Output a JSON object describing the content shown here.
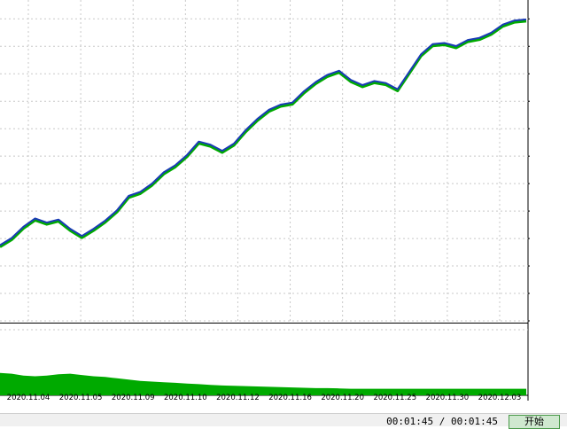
{
  "chart_data": [
    {
      "type": "line",
      "title": "",
      "xlabel": "",
      "ylabel": "",
      "ylim": [
        -68697,
        1460000
      ],
      "y_ticks": [
        1402557,
        1268806,
        1135056,
        1001306,
        867555,
        733805,
        600055,
        466305,
        332554,
        198804,
        65054,
        -68697
      ],
      "grid": true,
      "colors": {
        "balance": "#1a3bb5",
        "equity": "#00aa00"
      },
      "series": [
        {
          "values": [
            300000,
            335000,
            390000,
            430000,
            410000,
            425000,
            380000,
            345000,
            380000,
            420000,
            470000,
            540000,
            560000,
            600000,
            655000,
            690000,
            740000,
            805000,
            790000,
            760000,
            795000,
            860000,
            915000,
            960000,
            985000,
            995000,
            1050000,
            1095000,
            1130000,
            1150000,
            1105000,
            1080000,
            1100000,
            1090000,
            1060000,
            1145000,
            1230000,
            1280000,
            1285000,
            1270000,
            1300000,
            1310000,
            1335000,
            1375000,
            1395000,
            1400000
          ]
        }
      ]
    },
    {
      "type": "area",
      "ylim": [
        0,
        10
      ],
      "y_ticks": [
        "10.0%",
        "0.0%"
      ],
      "series": [
        {
          "values": [
            3.4,
            3.3,
            3.0,
            2.9,
            3.0,
            3.2,
            3.3,
            3.1,
            2.9,
            2.8,
            2.6,
            2.4,
            2.2,
            2.1,
            2.0,
            1.9,
            1.8,
            1.7,
            1.6,
            1.5,
            1.45,
            1.4,
            1.35,
            1.3,
            1.25,
            1.2,
            1.15,
            1.1,
            1.1,
            1.05,
            1.0,
            1.0,
            1.0,
            1.0,
            1.0,
            1.0,
            1.0,
            1.0,
            1.0,
            1.0,
            1.0,
            1.0,
            1.0,
            1.0,
            1.0,
            1.0
          ],
          "color": "#00aa00"
        }
      ]
    }
  ],
  "x_axis": {
    "labels": [
      "2020.11.04",
      "2020.11.05",
      "2020.11.09",
      "2020.11.10",
      "2020.11.12",
      "2020.11.16",
      "2020.11.20",
      "2020.11.25",
      "2020.11.30",
      "2020.12.03"
    ]
  },
  "bottom_bar": {
    "timer": "00:01:45 / 00:01:45",
    "start_label": "开始"
  }
}
